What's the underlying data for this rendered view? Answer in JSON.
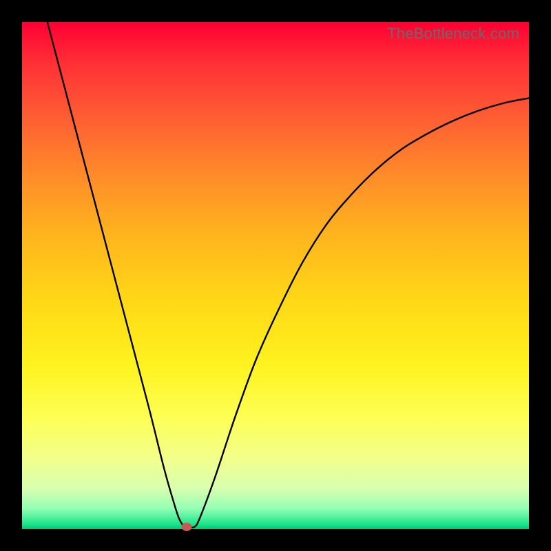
{
  "watermark": "TheBottleneck.com",
  "colors": {
    "curve": "#000000",
    "marker": "#c85a55",
    "frame": "#000000"
  },
  "chart_data": {
    "type": "line",
    "title": "",
    "xlabel": "",
    "ylabel": "",
    "xlim": [
      0,
      100
    ],
    "ylim": [
      0,
      100
    ],
    "grid": false,
    "legend": false,
    "series": [
      {
        "name": "bottleneck-curve",
        "x": [
          5,
          10,
          15,
          20,
          25,
          28,
          30,
          31,
          32,
          33,
          34,
          35,
          38,
          42,
          46,
          50,
          55,
          60,
          65,
          70,
          75,
          80,
          85,
          90,
          95,
          100
        ],
        "y": [
          100,
          81,
          62,
          43,
          24,
          12,
          5,
          2,
          0.5,
          0.4,
          0.4,
          2,
          10,
          22,
          33,
          42,
          52,
          60,
          66,
          71,
          75,
          78,
          80.5,
          82.5,
          84,
          85
        ]
      }
    ],
    "marker": {
      "x": 32.5,
      "y": 0.4
    },
    "notes": "Axes have no labels, ticks, or title in the source image; values are read in 0–100 percent space estimated from pixel geometry."
  }
}
